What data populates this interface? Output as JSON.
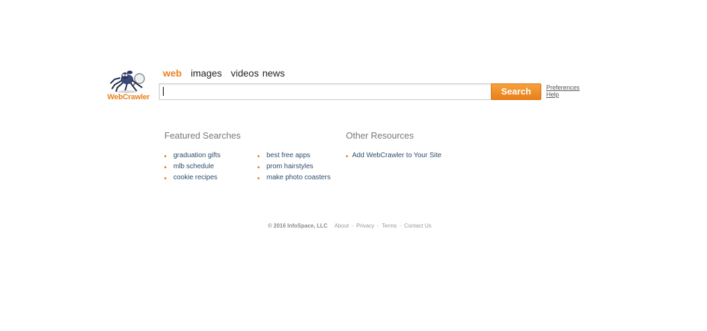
{
  "logo": {
    "text": "WebCrawler",
    "icon": "spider-mascot-icon",
    "color": "#e8821e"
  },
  "tabs": [
    {
      "label": "web",
      "active": true
    },
    {
      "label": "images",
      "active": false
    },
    {
      "label": "videos",
      "active": false
    },
    {
      "label": "news",
      "active": false
    }
  ],
  "search": {
    "value": "",
    "placeholder": "",
    "button_label": "Search"
  },
  "side_links": {
    "preferences": "Preferences",
    "help": "Help"
  },
  "featured": {
    "heading": "Featured Searches",
    "column1": [
      "graduation gifts",
      "mlb schedule",
      "cookie recipes"
    ],
    "column2": [
      "best free apps",
      "prom hairstyles",
      "make photo coasters"
    ]
  },
  "other": {
    "heading": "Other Resources",
    "items": [
      "Add WebCrawler to Your Site"
    ]
  },
  "footer": {
    "copyright": "© 2016 InfoSpace, LLC",
    "links": [
      "About",
      "Privacy",
      "Terms",
      "Contact Us"
    ],
    "separator": "-"
  },
  "colors": {
    "accent": "#e8821e",
    "link": "#2e4c6b",
    "heading": "#777777"
  }
}
